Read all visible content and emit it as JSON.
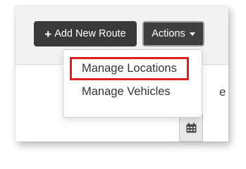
{
  "toolbar": {
    "add_route_label": "Add New Route",
    "actions_label": "Actions"
  },
  "actions_menu": {
    "items": [
      {
        "label": "Manage Locations",
        "highlighted": true
      },
      {
        "label": "Manage Vehicles",
        "highlighted": false
      }
    ]
  },
  "background": {
    "partial_text": "e"
  },
  "icons": {
    "add": "plus-icon",
    "actions": "caret-down-icon",
    "date": "calendar-icon"
  },
  "colors": {
    "button_bg": "#393939",
    "highlight_border": "#e01f1f"
  }
}
